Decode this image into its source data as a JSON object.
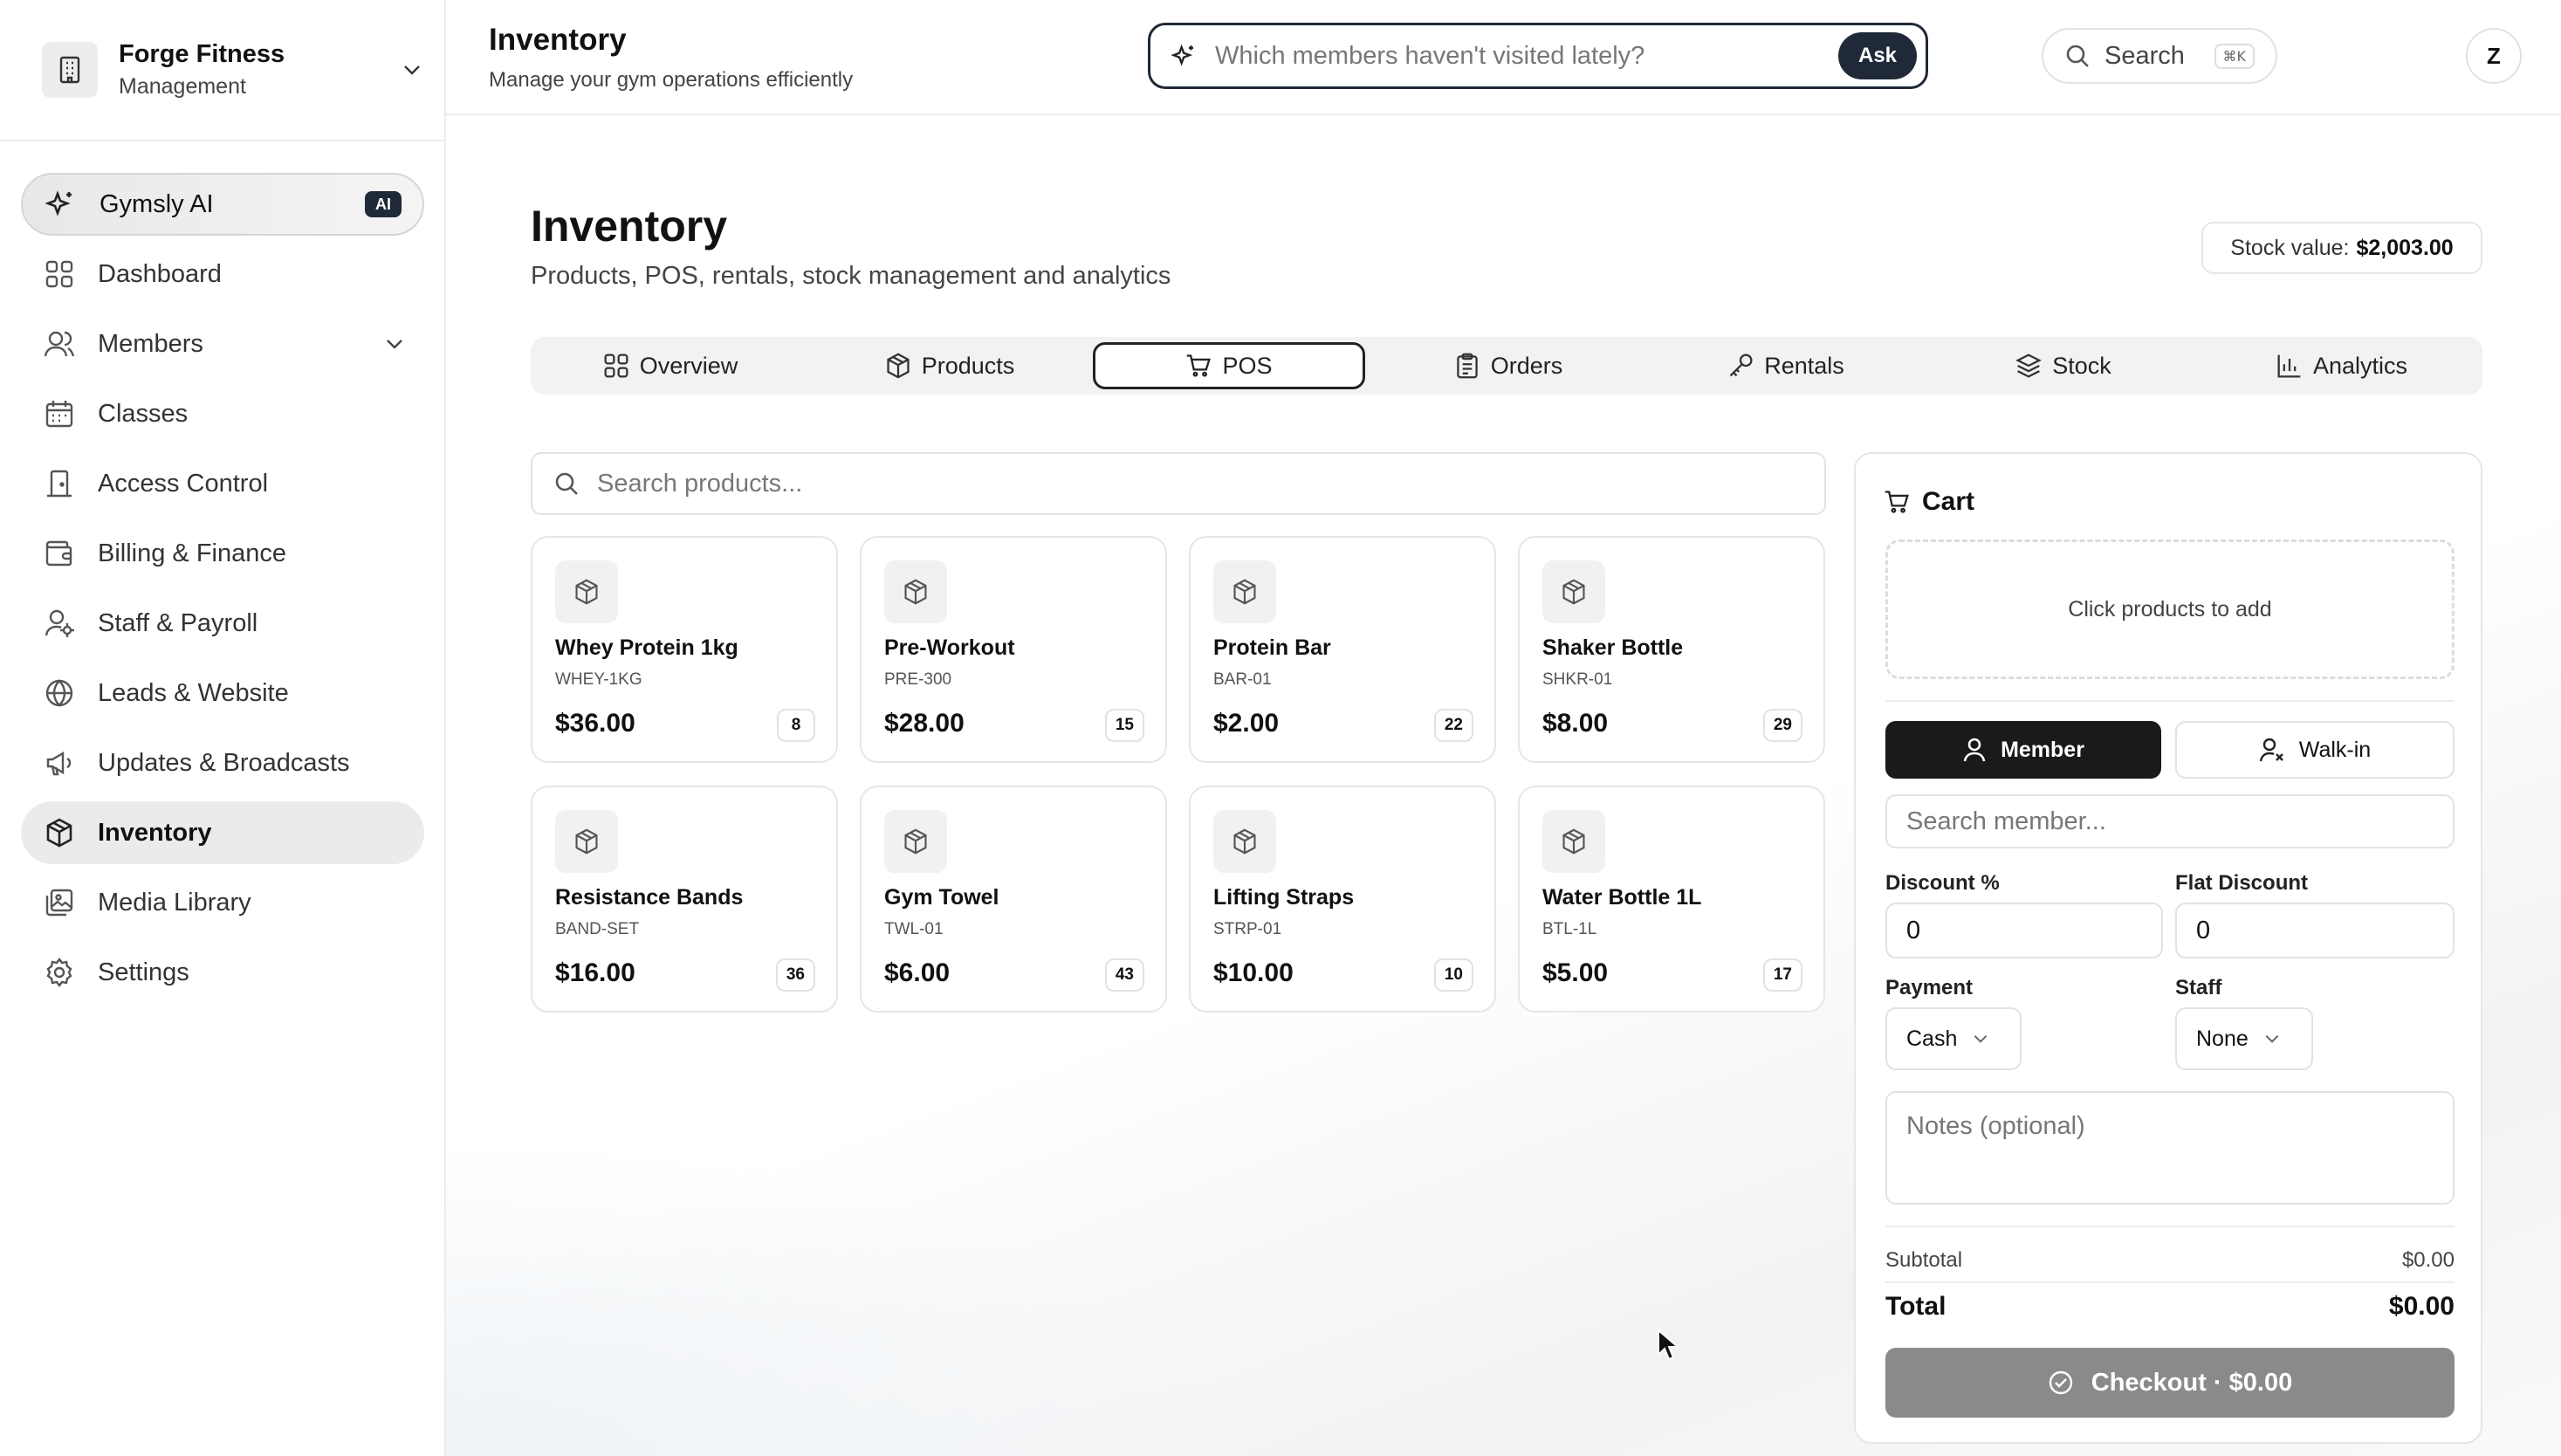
{
  "org": {
    "name": "Forge Fitness",
    "subtitle": "Management"
  },
  "nav": [
    {
      "label": "Gymsly AI",
      "badge": "AI",
      "icon": "sparkles-icon"
    },
    {
      "label": "Dashboard",
      "icon": "grid-icon"
    },
    {
      "label": "Members",
      "icon": "users-icon"
    },
    {
      "label": "Classes",
      "icon": "calendar-icon"
    },
    {
      "label": "Access Control",
      "icon": "door-icon"
    },
    {
      "label": "Billing & Finance",
      "icon": "wallet-icon"
    },
    {
      "label": "Staff & Payroll",
      "icon": "user-cog-icon"
    },
    {
      "label": "Leads & Website",
      "icon": "globe-icon"
    },
    {
      "label": "Updates & Broadcasts",
      "icon": "megaphone-icon"
    },
    {
      "label": "Inventory",
      "icon": "package-icon",
      "active": true
    },
    {
      "label": "Media Library",
      "icon": "images-icon"
    },
    {
      "label": "Settings",
      "icon": "gear-icon"
    }
  ],
  "header": {
    "title": "Inventory",
    "subtitle": "Manage your gym operations efficiently",
    "ask_placeholder": "Which members haven't visited lately?",
    "ask_button": "Ask",
    "search_label": "Search",
    "search_shortcut": "⌘K",
    "avatar": "Z"
  },
  "page": {
    "title": "Inventory",
    "subtitle": "Products, POS, rentals, stock management and analytics",
    "stock_value_label": "Stock value:",
    "stock_value": "$2,003.00"
  },
  "tabs": [
    {
      "label": "Overview",
      "icon": "grid-icon"
    },
    {
      "label": "Products",
      "icon": "package-icon"
    },
    {
      "label": "POS",
      "icon": "cart-icon",
      "active": true
    },
    {
      "label": "Orders",
      "icon": "clipboard-icon"
    },
    {
      "label": "Rentals",
      "icon": "key-icon"
    },
    {
      "label": "Stock",
      "icon": "layers-icon"
    },
    {
      "label": "Analytics",
      "icon": "bar-chart-icon"
    }
  ],
  "product_search_placeholder": "Search products...",
  "products": [
    {
      "name": "Whey Protein 1kg",
      "sku": "WHEY-1KG",
      "price": "$36.00",
      "qty": "8"
    },
    {
      "name": "Pre-Workout",
      "sku": "PRE-300",
      "price": "$28.00",
      "qty": "15"
    },
    {
      "name": "Protein Bar",
      "sku": "BAR-01",
      "price": "$2.00",
      "qty": "22"
    },
    {
      "name": "Shaker Bottle",
      "sku": "SHKR-01",
      "price": "$8.00",
      "qty": "29"
    },
    {
      "name": "Resistance Bands",
      "sku": "BAND-SET",
      "price": "$16.00",
      "qty": "36"
    },
    {
      "name": "Gym Towel",
      "sku": "TWL-01",
      "price": "$6.00",
      "qty": "43"
    },
    {
      "name": "Lifting Straps",
      "sku": "STRP-01",
      "price": "$10.00",
      "qty": "10"
    },
    {
      "name": "Water Bottle 1L",
      "sku": "BTL-1L",
      "price": "$5.00",
      "qty": "17"
    }
  ],
  "cart": {
    "title": "Cart",
    "empty_text": "Click products to add",
    "member_label": "Member",
    "walkin_label": "Walk-in",
    "search_member_placeholder": "Search member...",
    "discount_pct_label": "Discount %",
    "discount_pct_value": "0",
    "flat_discount_label": "Flat Discount",
    "flat_discount_value": "0",
    "payment_label": "Payment",
    "payment_value": "Cash",
    "staff_label": "Staff",
    "staff_value": "None",
    "notes_placeholder": "Notes (optional)",
    "subtotal_label": "Subtotal",
    "subtotal_value": "$0.00",
    "total_label": "Total",
    "total_value": "$0.00",
    "checkout_label": "Checkout · $0.00"
  }
}
